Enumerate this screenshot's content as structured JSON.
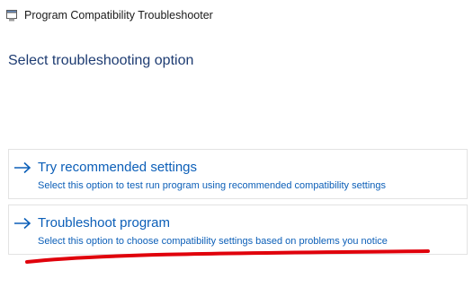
{
  "window": {
    "title": "Program Compatibility Troubleshooter",
    "icon": "troubleshooter-app-icon"
  },
  "heading": "Select troubleshooting option",
  "options": [
    {
      "icon": "arrow-right-icon",
      "title": "Try recommended settings",
      "description": "Select this option to test run program using recommended compatibility settings"
    },
    {
      "icon": "arrow-right-icon",
      "title": "Troubleshoot program",
      "description": "Select this option to choose compatibility settings based on problems you notice"
    }
  ],
  "colors": {
    "link": "#0c5fb8",
    "heading": "#1e3c72",
    "annotation": "#e0000b",
    "option_border": "#e3e3e3"
  }
}
